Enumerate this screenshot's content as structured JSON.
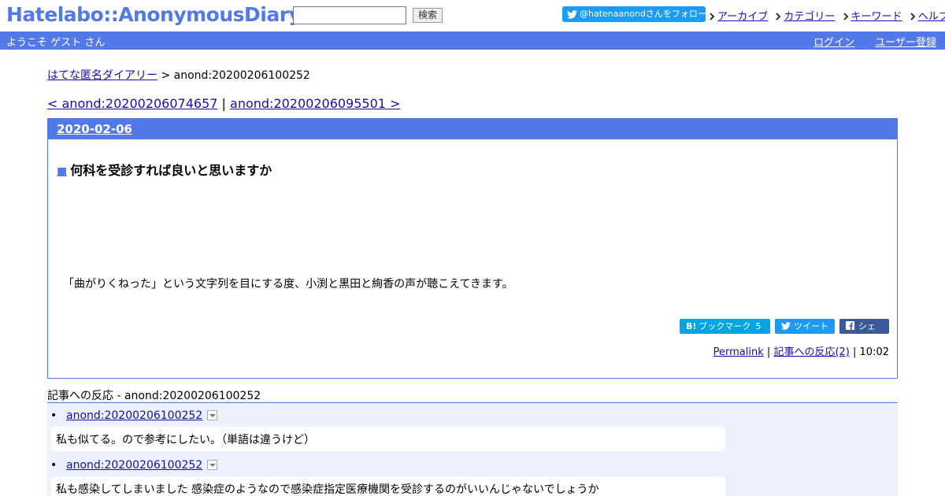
{
  "header": {
    "logo": "Hatelabo::AnonymousDiary",
    "search_value": "",
    "search_button": "検索",
    "follow_label": "@hatenaanondさんをフォロー",
    "nav": [
      "アーカイブ",
      "カテゴリー",
      "キーワード",
      "ヘルプ"
    ]
  },
  "welcome": {
    "text": "ようこそ ゲスト さん",
    "login": "ログイン",
    "register": "ユーザー登録"
  },
  "breadcrumb": {
    "home": "はてな匿名ダイアリー",
    "separator": ">",
    "current": "anond:20200206100252"
  },
  "pager": {
    "prev": "< anond:20200206074657",
    "separator": "|",
    "next": "anond:20200206095501 >"
  },
  "day": {
    "date": "2020-02-06",
    "entry": {
      "marker": "■",
      "title": "何科を受診すれば良いと思いますか",
      "body": "「曲がりくねった」という文字列を目にする度、小渕と黒田と絢香の声が聴こえてきます。",
      "bookmark_label": "ブックマーク",
      "bookmark_prefix": "B!",
      "bookmark_count": "5",
      "tweet_label": "ツイート",
      "share_label": "シェア",
      "permalink": "Permalink",
      "sep1": "|",
      "reactions_link": "記事への反応(2)",
      "sep2": "|",
      "time": "10:02"
    }
  },
  "reactions": {
    "title": "記事への反応 - anond:20200206100252",
    "items": [
      {
        "bullet": "•",
        "link": "anond:20200206100252",
        "body": "私も似てる。ので参考にしたい。（単語は違うけど）"
      },
      {
        "bullet": "•",
        "link": "anond:20200206100252",
        "body": "私も感染してしまいました 感染症のようなので感染症指定医療機関を受診するのがいいんじゃないでしょうか"
      }
    ]
  },
  "colors": {
    "brand": "#5279e7",
    "twitter": "#1d9bf0",
    "hatena_bookmark": "#00a4de",
    "facebook": "#3b5998",
    "reactions_bg": "#edf1fd"
  }
}
